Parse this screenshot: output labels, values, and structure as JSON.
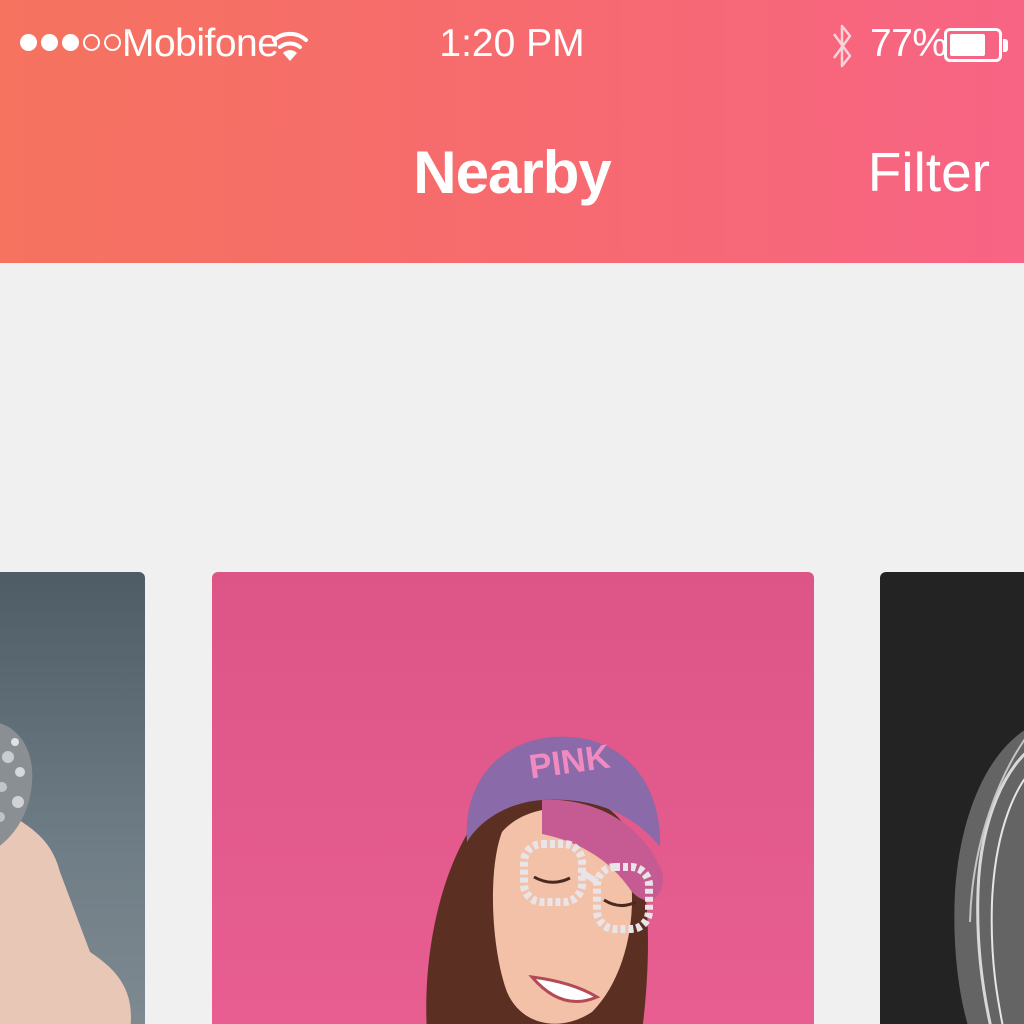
{
  "status_bar": {
    "carrier": "Mobifone",
    "signal_strength": 3,
    "signal_max": 5,
    "time": "1:20 PM",
    "battery_percent": "77%",
    "battery_level": 0.77
  },
  "nav": {
    "title": "Nearby",
    "filter_label": "Filter"
  },
  "cards": [
    {
      "id": "left",
      "background": "#5f6c75"
    },
    {
      "id": "center",
      "background": "#e05a8c",
      "cap_text": "PINK"
    },
    {
      "id": "right",
      "background": "#232323"
    }
  ],
  "colors": {
    "header_gradient_start": "#f5735f",
    "header_gradient_end": "#f76485",
    "content_background": "#f0f0f0"
  }
}
